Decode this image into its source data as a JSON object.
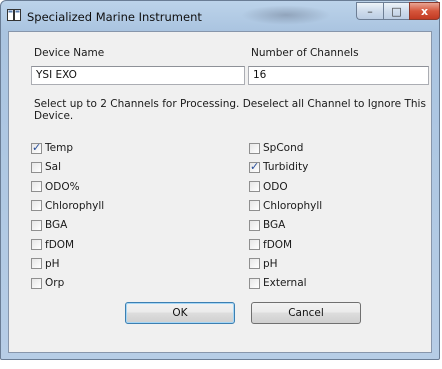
{
  "window": {
    "title": "Specialized Marine Instrument",
    "controls": {
      "minimize": "–",
      "maximize": "□",
      "close": "x"
    }
  },
  "device_name": {
    "label": "Device Name",
    "value": "YSI EXO"
  },
  "channels": {
    "label": "Number of Channels",
    "value": "16"
  },
  "instructions": "Select up to 2 Channels for Processing.  Deselect all Channel to Ignore This Device.",
  "left_channels": [
    {
      "label": "Temp",
      "checked": true
    },
    {
      "label": "Sal",
      "checked": false
    },
    {
      "label": "ODO%",
      "checked": false
    },
    {
      "label": "Chlorophyll",
      "checked": false
    },
    {
      "label": "BGA",
      "checked": false
    },
    {
      "label": "fDOM",
      "checked": false
    },
    {
      "label": "pH",
      "checked": false
    },
    {
      "label": "Orp",
      "checked": false
    }
  ],
  "right_channels": [
    {
      "label": "SpCond",
      "checked": false
    },
    {
      "label": "Turbidity",
      "checked": true
    },
    {
      "label": "ODO",
      "checked": false
    },
    {
      "label": "Chlorophyll",
      "checked": false
    },
    {
      "label": "BGA",
      "checked": false
    },
    {
      "label": "fDOM",
      "checked": false
    },
    {
      "label": "pH",
      "checked": false
    },
    {
      "label": "External",
      "checked": false
    }
  ],
  "buttons": {
    "ok": "OK",
    "cancel": "Cancel"
  }
}
